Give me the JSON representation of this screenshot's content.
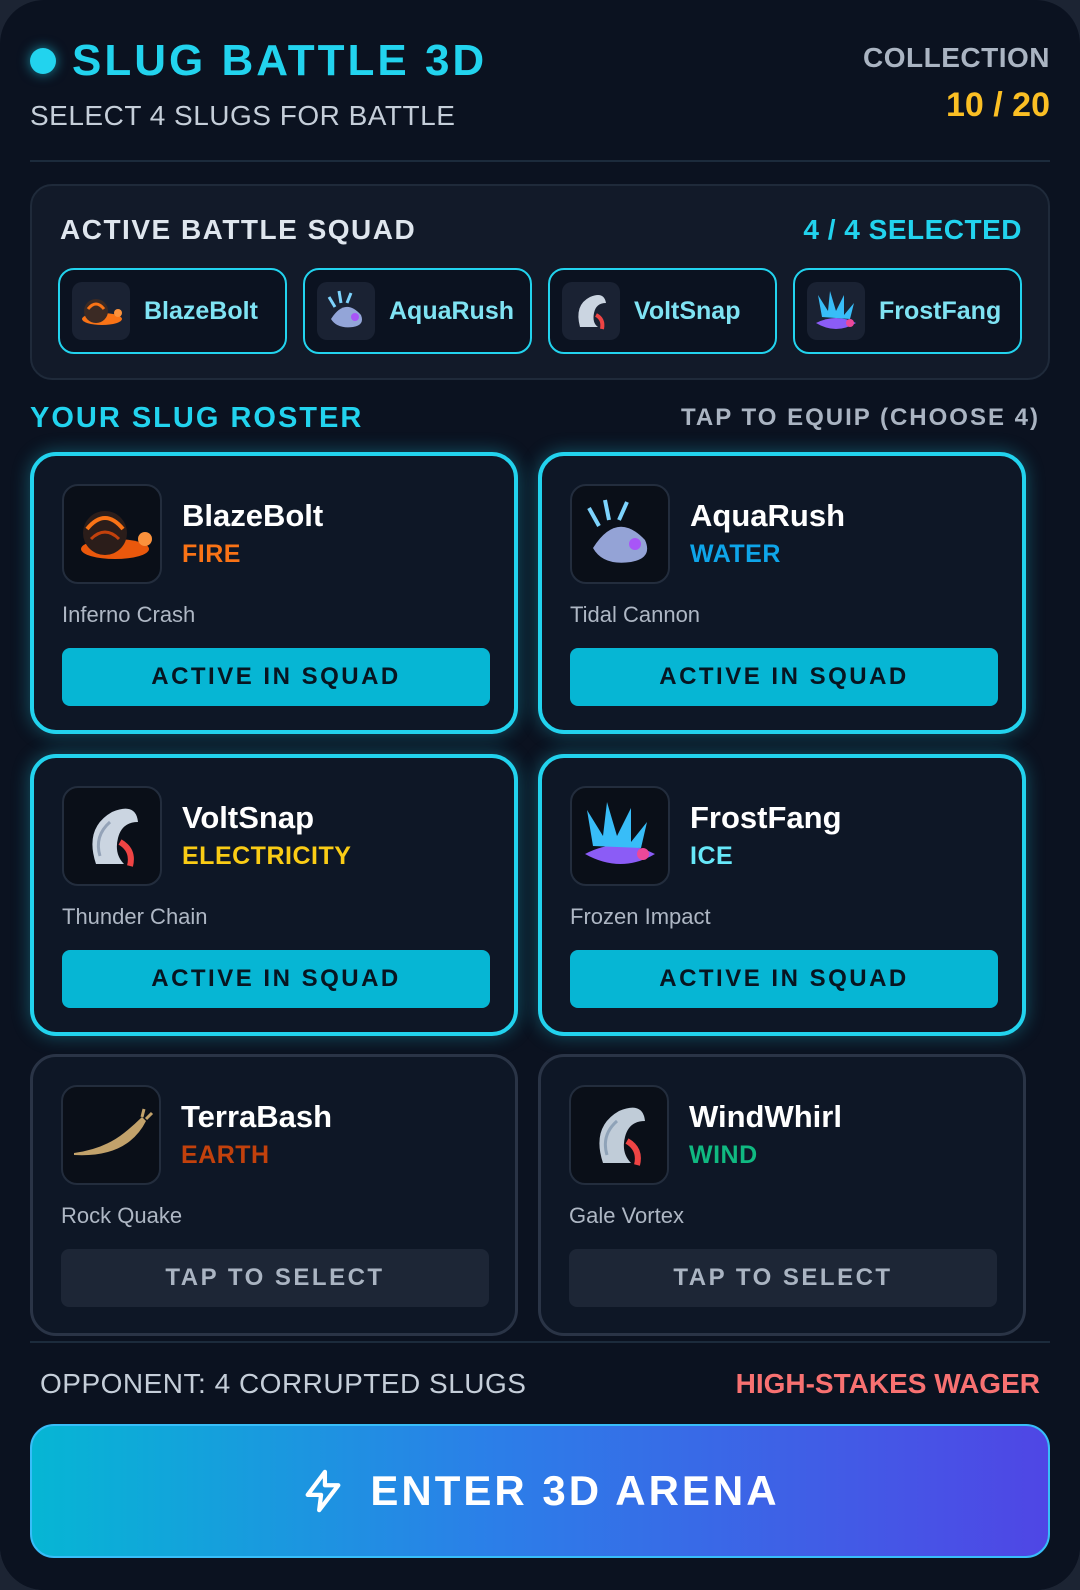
{
  "header": {
    "title": "SLUG BATTLE 3D",
    "subtitle": "SELECT 4 SLUGS FOR BATTLE",
    "collection_label": "COLLECTION",
    "collection_count": "10 / 20"
  },
  "squad": {
    "title": "ACTIVE BATTLE SQUAD",
    "count": "4 / 4 SELECTED",
    "slots": [
      {
        "name": "BlazeBolt",
        "icon": "fire-slug-icon"
      },
      {
        "name": "AquaRush",
        "icon": "water-slug-icon"
      },
      {
        "name": "VoltSnap",
        "icon": "electric-slug-icon"
      },
      {
        "name": "FrostFang",
        "icon": "ice-slug-icon"
      }
    ]
  },
  "roster": {
    "title": "YOUR SLUG ROSTER",
    "hint": "TAP TO EQUIP (CHOOSE 4)",
    "cards": [
      {
        "name": "BlazeBolt",
        "type": "FIRE",
        "type_color": "#f97316",
        "move": "Inferno Crash",
        "button": "ACTIVE IN SQUAD",
        "active": true
      },
      {
        "name": "AquaRush",
        "type": "WATER",
        "type_color": "#0ea5e9",
        "move": "Tidal Cannon",
        "button": "ACTIVE IN SQUAD",
        "active": true
      },
      {
        "name": "VoltSnap",
        "type": "ELECTRICITY",
        "type_color": "#facc15",
        "move": "Thunder Chain",
        "button": "ACTIVE IN SQUAD",
        "active": true
      },
      {
        "name": "FrostFang",
        "type": "ICE",
        "type_color": "#67e8f9",
        "move": "Frozen Impact",
        "button": "ACTIVE IN SQUAD",
        "active": true
      },
      {
        "name": "TerraBash",
        "type": "EARTH",
        "type_color": "#c2410c",
        "move": "Rock Quake",
        "button": "TAP TO SELECT",
        "active": false
      },
      {
        "name": "WindWhirl",
        "type": "WIND",
        "type_color": "#10b981",
        "move": "Gale Vortex",
        "button": "TAP TO SELECT",
        "active": false
      }
    ]
  },
  "footer": {
    "opponent": "OPPONENT: 4 CORRUPTED SLUGS",
    "wager": "HIGH-STAKES WAGER",
    "arena_button": "ENTER 3D ARENA",
    "arena_icon": "lightning-icon"
  }
}
